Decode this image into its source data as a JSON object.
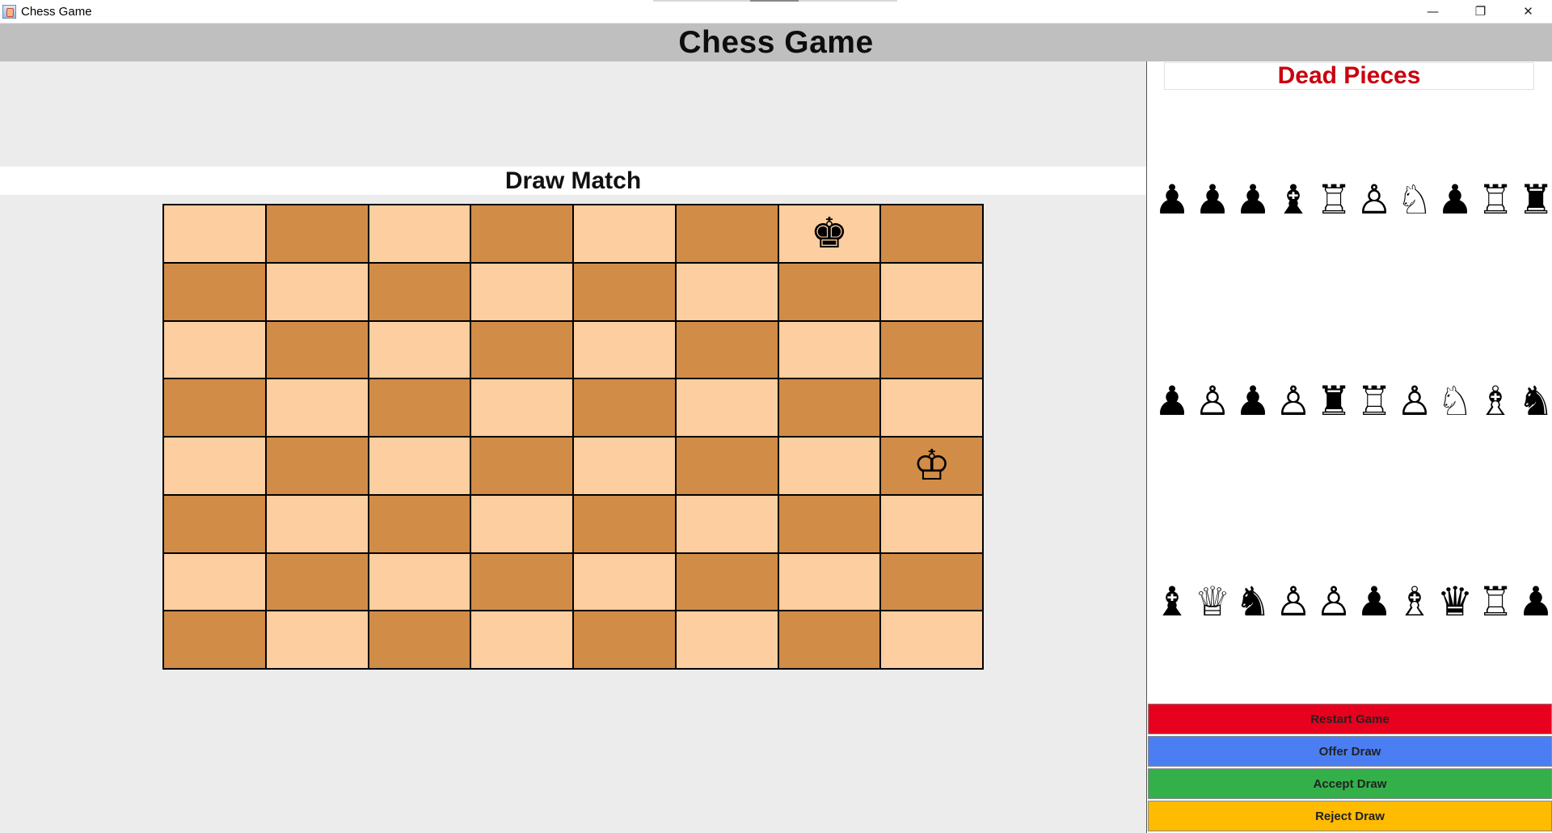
{
  "window": {
    "title": "Chess Game",
    "controls": {
      "minimize": "—",
      "restore": "❐",
      "close": "✕"
    }
  },
  "header": {
    "title": "Chess Game"
  },
  "status": {
    "text": "Draw Match"
  },
  "board": {
    "rows": [
      [
        "",
        "",
        "",
        "",
        "",
        "",
        "♚",
        ""
      ],
      [
        "",
        "",
        "",
        "",
        "",
        "",
        "",
        ""
      ],
      [
        "",
        "",
        "",
        "",
        "",
        "",
        "",
        ""
      ],
      [
        "",
        "",
        "",
        "",
        "",
        "",
        "",
        ""
      ],
      [
        "",
        "",
        "",
        "",
        "",
        "",
        "",
        "♔"
      ],
      [
        "",
        "",
        "",
        "",
        "",
        "",
        "",
        ""
      ],
      [
        "",
        "",
        "",
        "",
        "",
        "",
        "",
        ""
      ],
      [
        "",
        "",
        "",
        "",
        "",
        "",
        "",
        ""
      ]
    ],
    "colors": {
      "light": "#fccea0",
      "dark": "#d18c47"
    }
  },
  "dead_pieces": {
    "title": "Dead Pieces",
    "title_color": "#c9000f",
    "rows": [
      [
        "♟",
        "♟",
        "♟",
        "♝",
        "♖",
        "♙",
        "♘",
        "♟",
        "♖",
        "♜"
      ],
      [
        "♟",
        "♙",
        "♟",
        "♙",
        "♜",
        "♖",
        "♙",
        "♘",
        "♗",
        "♞"
      ],
      [
        "♝",
        "♕",
        "♞",
        "♙",
        "♙",
        "♟",
        "♗",
        "♛",
        "♖",
        "♟"
      ]
    ]
  },
  "buttons": {
    "restart": {
      "label": "Restart Game",
      "color": "#e8001f"
    },
    "offer_draw": {
      "label": "Offer Draw",
      "color": "#4a7ef2"
    },
    "accept_draw": {
      "label": "Accept Draw",
      "color": "#33b04a"
    },
    "reject_draw": {
      "label": "Reject Draw",
      "color": "#ffbb00"
    }
  }
}
